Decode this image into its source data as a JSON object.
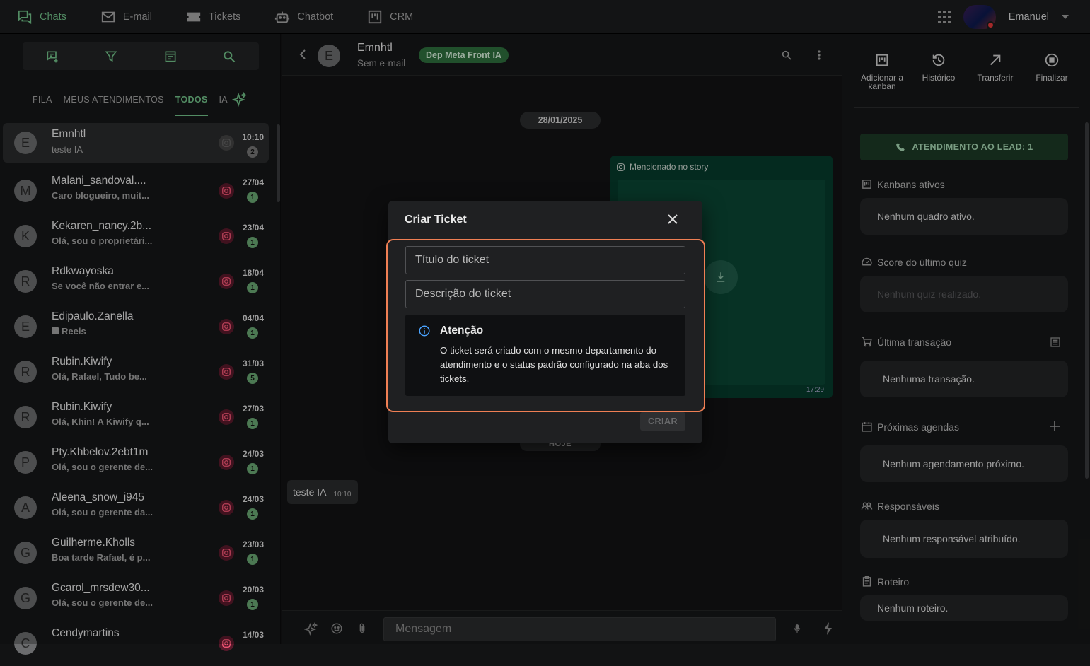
{
  "nav": {
    "items": [
      {
        "label": "Chats",
        "icon": "chats-icon"
      },
      {
        "label": "E-mail",
        "icon": "email-icon"
      },
      {
        "label": "Tickets",
        "icon": "tickets-icon"
      },
      {
        "label": "Chatbot",
        "icon": "chatbot-icon"
      },
      {
        "label": "CRM",
        "icon": "crm-icon"
      }
    ],
    "user": "Emanuel"
  },
  "tabs": {
    "fila": "FILA",
    "meus": "MEUS ATENDIMENTOS",
    "todos": "TODOS",
    "ia": "IA"
  },
  "chats": [
    {
      "initial": "E",
      "name": "Emnhtl",
      "preview": "teste IA",
      "time": "10:10",
      "count": "2"
    },
    {
      "initial": "M",
      "name": "Malani_sandoval....",
      "preview": "Caro blogueiro, muit...",
      "time": "27/04",
      "count": "1"
    },
    {
      "initial": "K",
      "name": "Kekaren_nancy.2b...",
      "preview": "Olá, sou o proprietári...",
      "time": "23/04",
      "count": "1"
    },
    {
      "initial": "R",
      "name": "Rdkwayoska",
      "preview": "Se você não entrar e...",
      "time": "18/04",
      "count": "1"
    },
    {
      "initial": "E",
      "name": "Edipaulo.Zanella",
      "preview": "Reels",
      "time": "04/04",
      "count": "1"
    },
    {
      "initial": "R",
      "name": "Rubin.Kiwify",
      "preview": "Olá, Rafael, Tudo be...",
      "time": "31/03",
      "count": "5"
    },
    {
      "initial": "R",
      "name": "Rubin.Kiwify",
      "preview": "Olá, Khin! A Kiwify q...",
      "time": "27/03",
      "count": "1"
    },
    {
      "initial": "P",
      "name": "Pty.Khbelov.2ebt1m",
      "preview": "Olá, sou o gerente de...",
      "time": "24/03",
      "count": "1"
    },
    {
      "initial": "A",
      "name": "Aleena_snow_i945",
      "preview": "Olá, sou o gerente da...",
      "time": "24/03",
      "count": "1"
    },
    {
      "initial": "G",
      "name": "Guilherme.Kholls",
      "preview": "Boa tarde Rafael, é p...",
      "time": "23/03",
      "count": "1"
    },
    {
      "initial": "G",
      "name": "Gcarol_mrsdew30...",
      "preview": "Olá, sou o gerente de...",
      "time": "20/03",
      "count": "1"
    },
    {
      "initial": "C",
      "name": "Cendymartins_",
      "preview": "",
      "time": "14/03",
      "count": ""
    }
  ],
  "conversation": {
    "initial": "E",
    "name": "Emnhtl",
    "email": "Sem e-mail",
    "department": "Dep Meta Front IA",
    "date": "28/01/2025",
    "story_label": "Mencionado no story",
    "story_time": "17:29",
    "today": "HOJE",
    "message": "teste IA",
    "message_time": "10:10",
    "composer_placeholder": "Mensagem"
  },
  "right": {
    "actions": [
      {
        "label": "Adicionar a kanban",
        "icon": "kanban-icon"
      },
      {
        "label": "Histórico",
        "icon": "history-icon"
      },
      {
        "label": "Transferir",
        "icon": "transfer-icon"
      },
      {
        "label": "Finalizar",
        "icon": "finish-icon"
      }
    ],
    "lead_button": "ATENDIMENTO AO LEAD: 1",
    "kanbans_title": "Kanbans ativos",
    "kanbans_empty": "Nenhum quadro ativo.",
    "quiz_title": "Score do último quiz",
    "quiz_empty": "Nenhum quiz realizado.",
    "transacao_title": "Última transação",
    "transacao_empty": "Nenhuma transação.",
    "agendas_title": "Próximas agendas",
    "agendas_empty": "Nenhum agendamento próximo.",
    "responsaveis_title": "Responsáveis",
    "responsaveis_empty": "Nenhum responsável atribuído.",
    "roteiro_title": "Roteiro",
    "roteiro_empty": "Nenhum roteiro."
  },
  "modal": {
    "title": "Criar Ticket",
    "title_placeholder": "Título do ticket",
    "desc_placeholder": "Descrição do ticket",
    "warn_title": "Atenção",
    "warn_body": "O ticket será criado com o mesmo departamento do atendimento e o status padrão configurado na aba dos tickets.",
    "submit": "CRIAR"
  }
}
